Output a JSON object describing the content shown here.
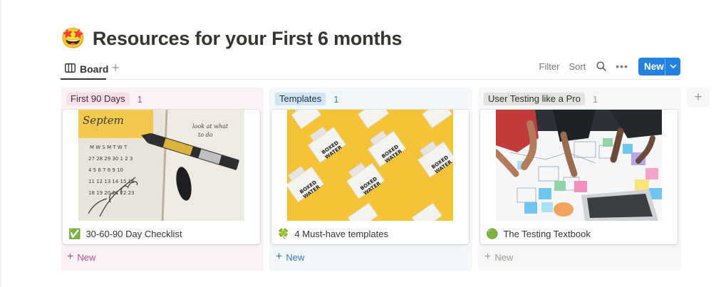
{
  "page": {
    "emoji": "🤩",
    "title": "Resources for your First 6 months"
  },
  "view_bar": {
    "active_view_icon": "board-icon",
    "active_view_label": "Board",
    "add_view_icon": "plus-icon",
    "add_view_label": "+"
  },
  "toolbar": {
    "filter_label": "Filter",
    "sort_label": "Sort",
    "search_icon": "search-icon",
    "more_label": "•••",
    "new_label": "New",
    "new_caret_icon": "chevron-down-icon"
  },
  "columns": [
    {
      "label": "First 90 Days",
      "count": "1",
      "colors": {
        "background": "#fbf2f5",
        "pill_bg": "#f5e0e9",
        "pill_text": "#4c2337",
        "count_text": "#c14c8a"
      },
      "card": {
        "emoji": "✅",
        "title": "30-60-90 Day Checklist",
        "cover": "calendar-notebook-photo"
      },
      "new_label": "New"
    },
    {
      "label": "Templates",
      "count": "1",
      "colors": {
        "background": "#f1f7fb",
        "pill_bg": "#d3e5ef",
        "pill_text": "#183347",
        "count_text": "#337ea9"
      },
      "card": {
        "emoji": "🍀",
        "title": "4 Must-have templates",
        "cover": "boxed-water-cartons-photo"
      },
      "new_label": "New"
    },
    {
      "label": "User Testing like a Pro",
      "count": "1",
      "colors": {
        "background": "#f7f7f5",
        "pill_bg": "#e3e2e0",
        "pill_text": "#32302c",
        "count_text": "#9b9a97"
      },
      "card": {
        "emoji": "🟢",
        "title": "The Testing Textbook",
        "cover": "team-sticky-notes-photo"
      },
      "new_label": "New"
    }
  ],
  "add_group_label": "+",
  "colors": {
    "accent": "#2383e2",
    "text": "#37352f",
    "muted": "#787774"
  }
}
